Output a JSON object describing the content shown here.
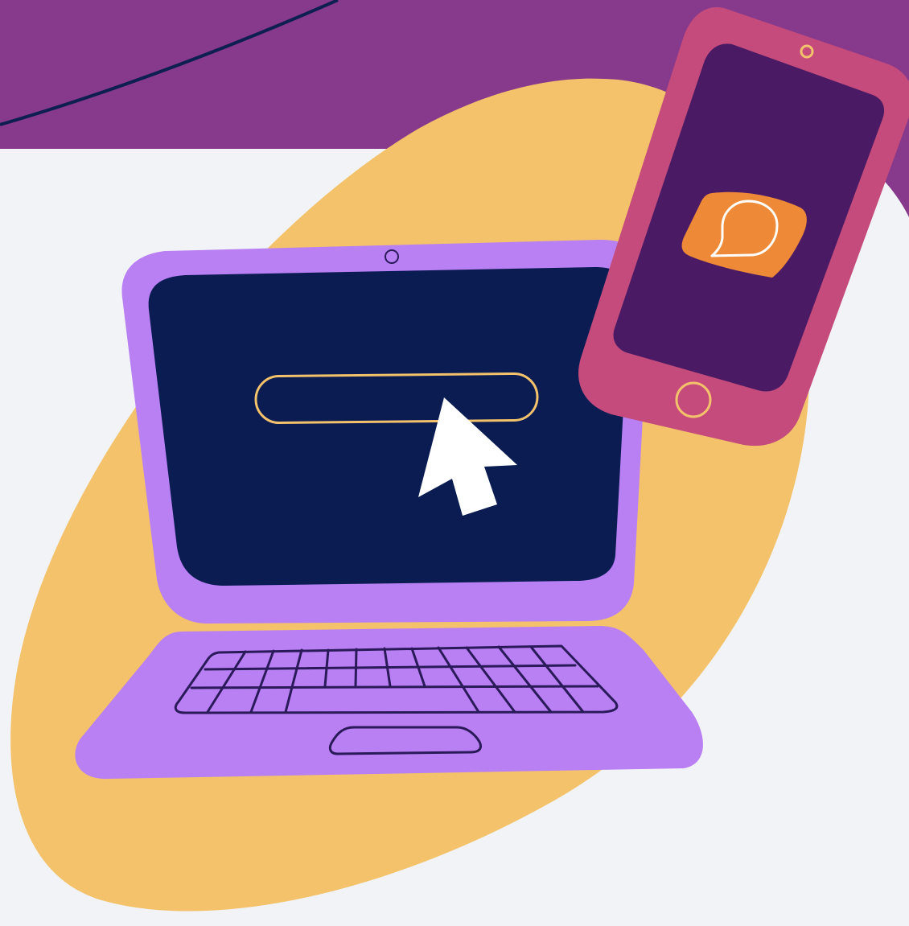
{
  "illustration": {
    "background": "#f2f3f6",
    "top_band_color": "#87398c",
    "top_band_line_color": "#0d1f4f",
    "blob_color": "#f3c26b",
    "laptop": {
      "body_color": "#b980f4",
      "screen_color": "#0b1c53",
      "outline_color": "#2a1a5a",
      "search_bar_outline_color": "#f3c26b",
      "cursor_color": "#ffffff",
      "icons": [
        "webcam-icon",
        "search-bar",
        "mouse-pointer-icon",
        "keyboard",
        "trackpad"
      ]
    },
    "phone": {
      "body_color": "#c44b7c",
      "screen_color": "#4a1b64",
      "camera_color": "#f3c26b",
      "app_icon_color": "#ee8a37",
      "icons": [
        "phone-camera-icon",
        "chat-bubble-icon",
        "home-button-icon"
      ]
    }
  }
}
